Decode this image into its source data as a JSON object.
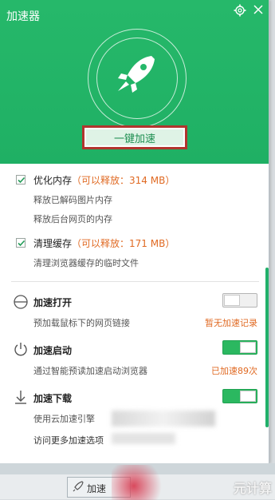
{
  "app": {
    "title": "加速器"
  },
  "hero": {
    "accelerate_button": "一键加速"
  },
  "cleanup": [
    {
      "title": "优化内存",
      "hint": "（可以释放：314 MB）",
      "lines": [
        "释放已解码图片内存",
        "释放后台网页的内存"
      ],
      "checked": true
    },
    {
      "title": "清理缓存",
      "hint": "（可以释放：171 MB）",
      "lines": [
        "清理浏览器缓存的临时文件"
      ],
      "checked": true
    }
  ],
  "features": [
    {
      "title": "加速打开",
      "desc": "预加载鼠标下的网页链接",
      "status": "暂无加速记录",
      "icon": "half-circle-icon",
      "enabled": false
    },
    {
      "title": "加速启动",
      "desc": "通过智能预读加速启动浏览器",
      "status": "已加速89次",
      "icon": "power-icon",
      "enabled": true
    },
    {
      "title": "加速下载",
      "desc": "使用云加速引擎",
      "status": "",
      "icon": "download-icon",
      "enabled": true
    }
  ],
  "more_link": "访问更多加速选项",
  "taskbar": {
    "item_label": "加速"
  },
  "watermark": "元计算",
  "colors": {
    "brand_green": "#22b366",
    "accent_orange": "#e06a23",
    "highlight_red": "#b1352e"
  }
}
